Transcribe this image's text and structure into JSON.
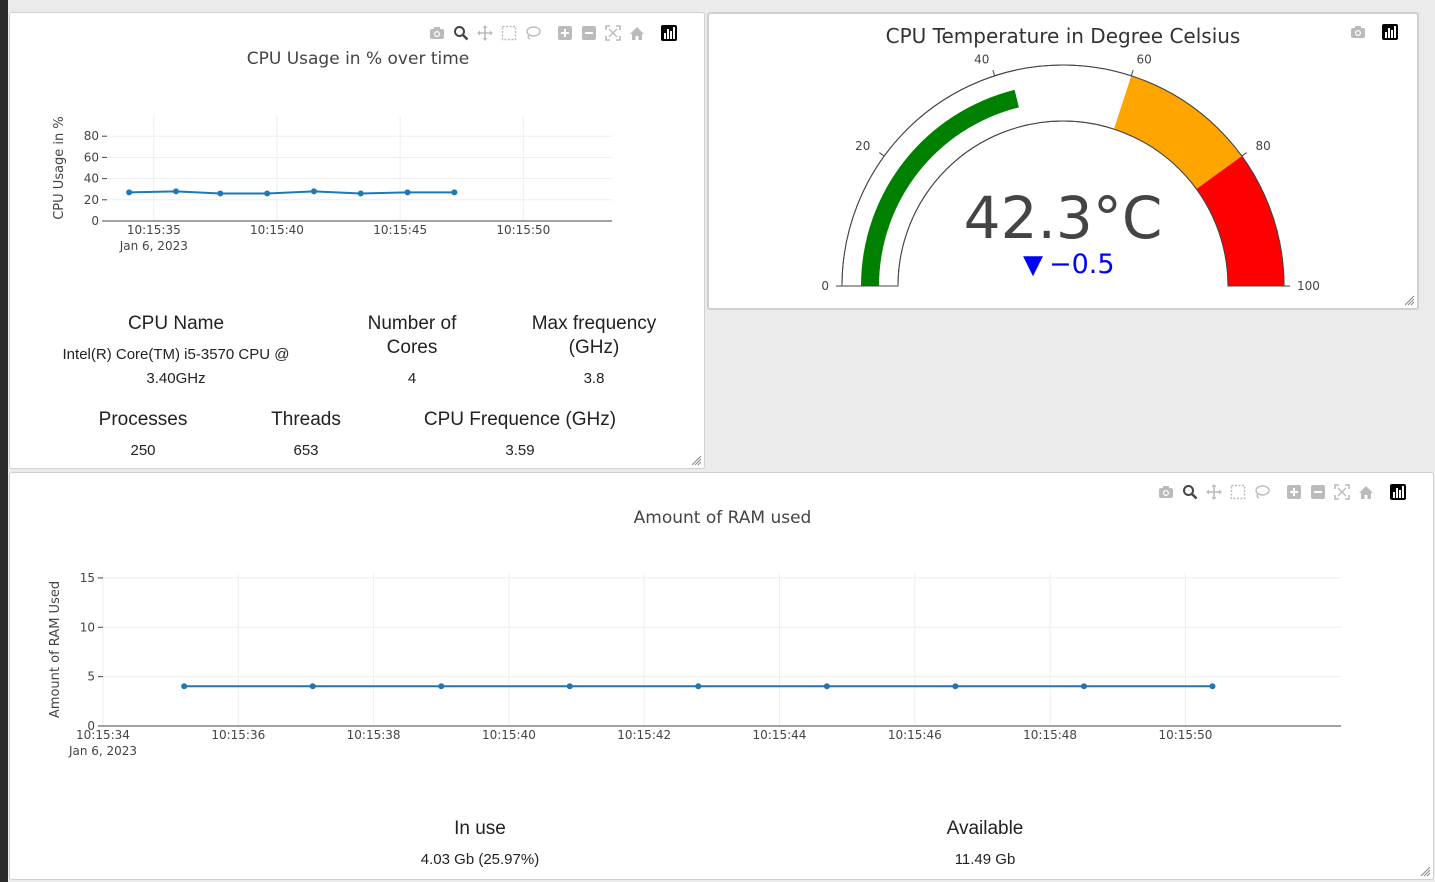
{
  "cpu_panel": {
    "title": "CPU Usage in % over time",
    "chart_data": {
      "type": "line",
      "title": "CPU Usage in % over time",
      "xlabel": "",
      "ylabel": "CPU Usage in %",
      "x": [
        "10:15:34.0",
        "10:15:35.9",
        "10:15:37.7",
        "10:15:39.6",
        "10:15:41.5",
        "10:15:43.4",
        "10:15:45.3",
        "10:15:47.2"
      ],
      "x_seconds": [
        34.0,
        35.9,
        37.7,
        39.6,
        41.5,
        43.4,
        45.3,
        47.2
      ],
      "y": [
        27,
        28,
        26,
        26,
        28,
        26,
        27,
        27
      ],
      "xlim_seconds": [
        33.1,
        53.6
      ],
      "ylim": [
        0,
        100
      ],
      "yticks": [
        "0",
        "20",
        "40",
        "60",
        "80"
      ],
      "xticks": [
        {
          "seconds": 35,
          "label": "10:15:35",
          "sublabel": "Jan 6, 2023"
        },
        {
          "seconds": 40,
          "label": "10:15:40"
        },
        {
          "seconds": 45,
          "label": "10:15:45"
        },
        {
          "seconds": 50,
          "label": "10:15:50"
        }
      ],
      "line_color": "#1f77b4",
      "grid": true
    },
    "stats": {
      "cpu_name_label": "CPU Name",
      "cpu_name_value_line1": "Intel(R) Core(TM) i5-3570 CPU @",
      "cpu_name_value_line2": "3.40GHz",
      "cores_label_line1": "Number of",
      "cores_label_line2": "Cores",
      "cores_value": "4",
      "maxfreq_label_line1": "Max frequency",
      "maxfreq_label_line2": "(GHz)",
      "maxfreq_value": "3.8",
      "processes_label": "Processes",
      "processes_value": "250",
      "threads_label": "Threads",
      "threads_value": "653",
      "freq_label": "CPU Frequence (GHz)",
      "freq_value": "3.59"
    }
  },
  "temp_panel": {
    "title": "CPU Temperature in Degree Celsius",
    "chart_data": {
      "type": "gauge",
      "value": 42.3,
      "value_text": "42.3°C",
      "delta": -0.5,
      "delta_text": "−0.5",
      "delta_arrow": "▼",
      "range": [
        0,
        100
      ],
      "ticks": [
        "0",
        "20",
        "40",
        "60",
        "80",
        "100"
      ],
      "steps": [
        {
          "range": [
            60,
            80
          ],
          "color": "#ffa500"
        },
        {
          "range": [
            80,
            100
          ],
          "color": "#ff0000"
        }
      ],
      "bar_color": "#008000",
      "delta_color": "#0000ff"
    }
  },
  "ram_panel": {
    "title": "Amount of RAM used",
    "chart_data": {
      "type": "line",
      "title": "Amount of RAM used",
      "xlabel": "",
      "ylabel": "Amount of RAM Used",
      "x": [
        "10:15:35.2",
        "10:15:37.1",
        "10:15:39.0",
        "10:15:40.9",
        "10:15:42.8",
        "10:15:44.7",
        "10:15:46.6",
        "10:15:48.5",
        "10:15:50.4"
      ],
      "x_seconds": [
        35.2,
        37.1,
        39.0,
        40.9,
        42.8,
        44.7,
        46.6,
        48.5,
        50.4
      ],
      "y": [
        4.03,
        4.03,
        4.03,
        4.03,
        4.03,
        4.03,
        4.03,
        4.03,
        4.03
      ],
      "xlim_seconds": [
        34.0,
        52.3
      ],
      "ylim": [
        0,
        15.5
      ],
      "yticks": [
        "0",
        "5",
        "10",
        "15"
      ],
      "xticks": [
        {
          "seconds": 34,
          "label": "10:15:34",
          "sublabel": "Jan 6, 2023"
        },
        {
          "seconds": 36,
          "label": "10:15:36"
        },
        {
          "seconds": 38,
          "label": "10:15:38"
        },
        {
          "seconds": 40,
          "label": "10:15:40"
        },
        {
          "seconds": 42,
          "label": "10:15:42"
        },
        {
          "seconds": 44,
          "label": "10:15:44"
        },
        {
          "seconds": 46,
          "label": "10:15:46"
        },
        {
          "seconds": 48,
          "label": "10:15:48"
        },
        {
          "seconds": 50,
          "label": "10:15:50"
        }
      ],
      "line_color": "#1f77b4",
      "grid": true
    },
    "stats": {
      "inuse_label": "In use",
      "inuse_value": "4.03 Gb (25.97%)",
      "available_label": "Available",
      "available_value": "11.49 Gb"
    }
  },
  "modebar_icons": [
    "camera-icon",
    "zoom-icon",
    "pan-icon",
    "box-select-icon",
    "lasso-select-icon",
    "zoom-in-icon",
    "zoom-out-icon",
    "autoscale-icon",
    "reset-axes-icon",
    "plotly-logo-icon"
  ]
}
